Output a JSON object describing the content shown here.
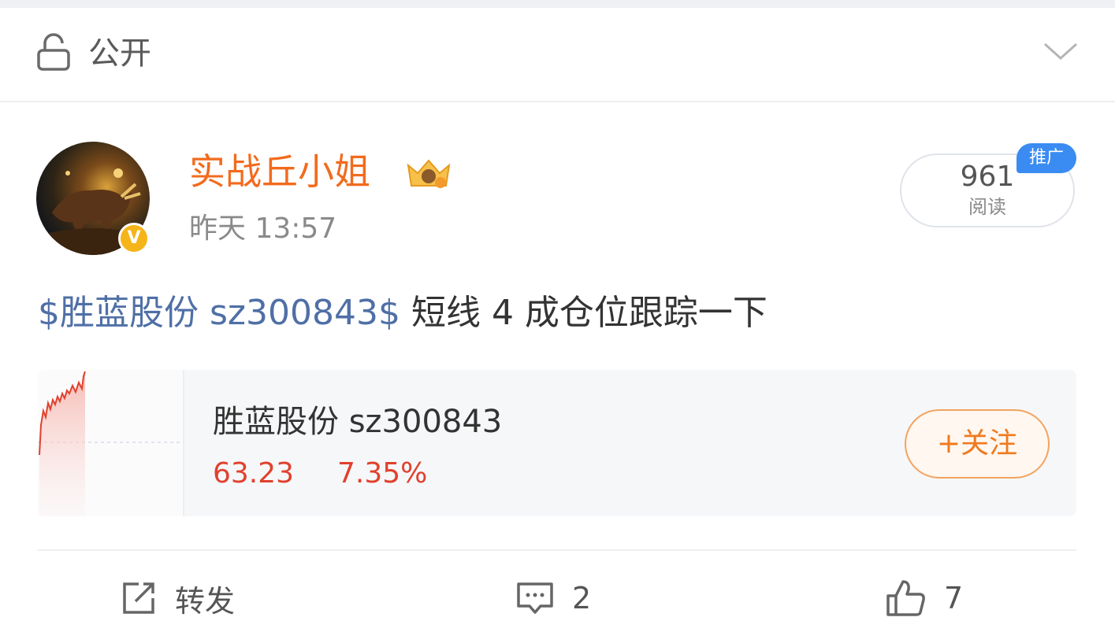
{
  "visibility": {
    "label": "公开"
  },
  "author": {
    "name": "实战丘小姐",
    "timestamp": "昨天 13:57",
    "verified_mark": "V"
  },
  "reads": {
    "count": "961",
    "label": "阅读",
    "promo_tag": "推广"
  },
  "post": {
    "stock_tag": "$胜蓝股份 sz300843$",
    "body": "短线 4 成仓位跟踪一下"
  },
  "stock_card": {
    "name": "胜蓝股份 sz300843",
    "price": "63.23",
    "change_pct": "7.35%",
    "follow_label": "+关注"
  },
  "actions": {
    "repost_label": "转发",
    "comment_count": "2",
    "like_count": "7"
  },
  "colors": {
    "accent_orange": "#f26b1d",
    "stock_link": "#4f6fa6",
    "price_up": "#e0412d",
    "promo_blue": "#3a8cf2"
  }
}
